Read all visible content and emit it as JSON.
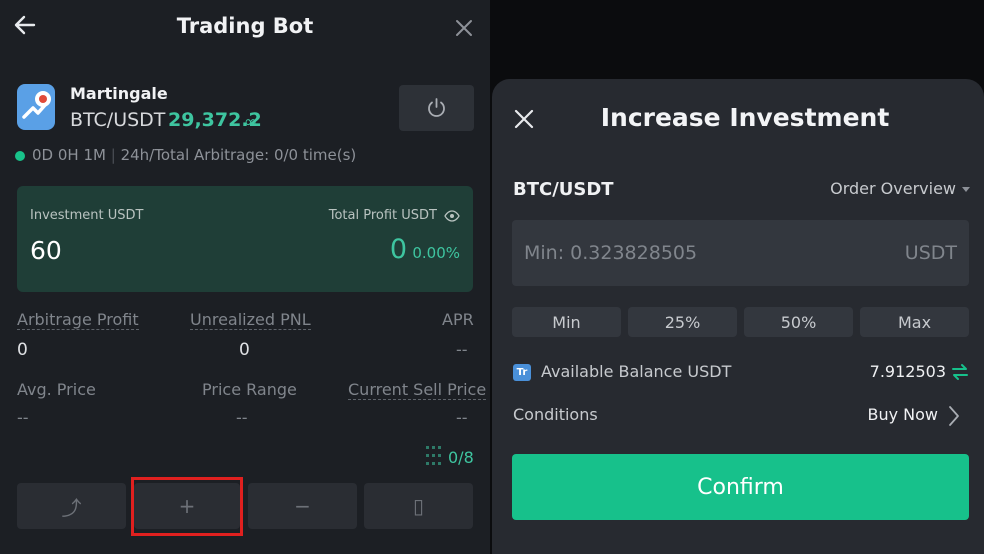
{
  "bot": {
    "title": "Trading Bot",
    "strategy": "Martingale",
    "pair": "BTC/USDT",
    "price": "29,372.2",
    "price_suffix": "∞",
    "runtime": "0D 0H 1M",
    "arbitrage_info": "24h/Total Arbitrage: 0/0 time(s)",
    "investment_label": "Investment USDT",
    "investment_value": "60",
    "total_profit_label": "Total Profit USDT",
    "total_profit_value": "0",
    "total_profit_pct": "0.00%",
    "stats": [
      {
        "label": "Arbitrage Profit",
        "value": "0"
      },
      {
        "label": "Unrealized PNL",
        "value": "0"
      },
      {
        "label": "APR",
        "value": "--"
      },
      {
        "label": "Avg. Price",
        "value": "--"
      },
      {
        "label": "Price Range",
        "value": "--"
      },
      {
        "label": "Current Sell Price",
        "value": "--"
      }
    ],
    "orders_count": "0/8",
    "bottom_buttons": {
      "share": "⤴",
      "add": "+",
      "reduce": "−",
      "details": "▯"
    }
  },
  "sheet": {
    "title": "Increase Investment",
    "pair": "BTC/USDT",
    "order_overview": "Order Overview",
    "amount_placeholder": "Min: 0.323828505",
    "amount_unit": "USDT",
    "percent_buttons": [
      "Min",
      "25%",
      "50%",
      "Max"
    ],
    "currency_badge": "Tr",
    "available_label": "Available Balance USDT",
    "available_value": "7.912503",
    "conditions_label": "Conditions",
    "conditions_value": "Buy Now",
    "confirm_label": "Confirm"
  },
  "colors": {
    "accent": "#17c18b",
    "profit": "#3ec5a0",
    "card_bg": "#1f3e37",
    "highlight": "#e0201f"
  }
}
